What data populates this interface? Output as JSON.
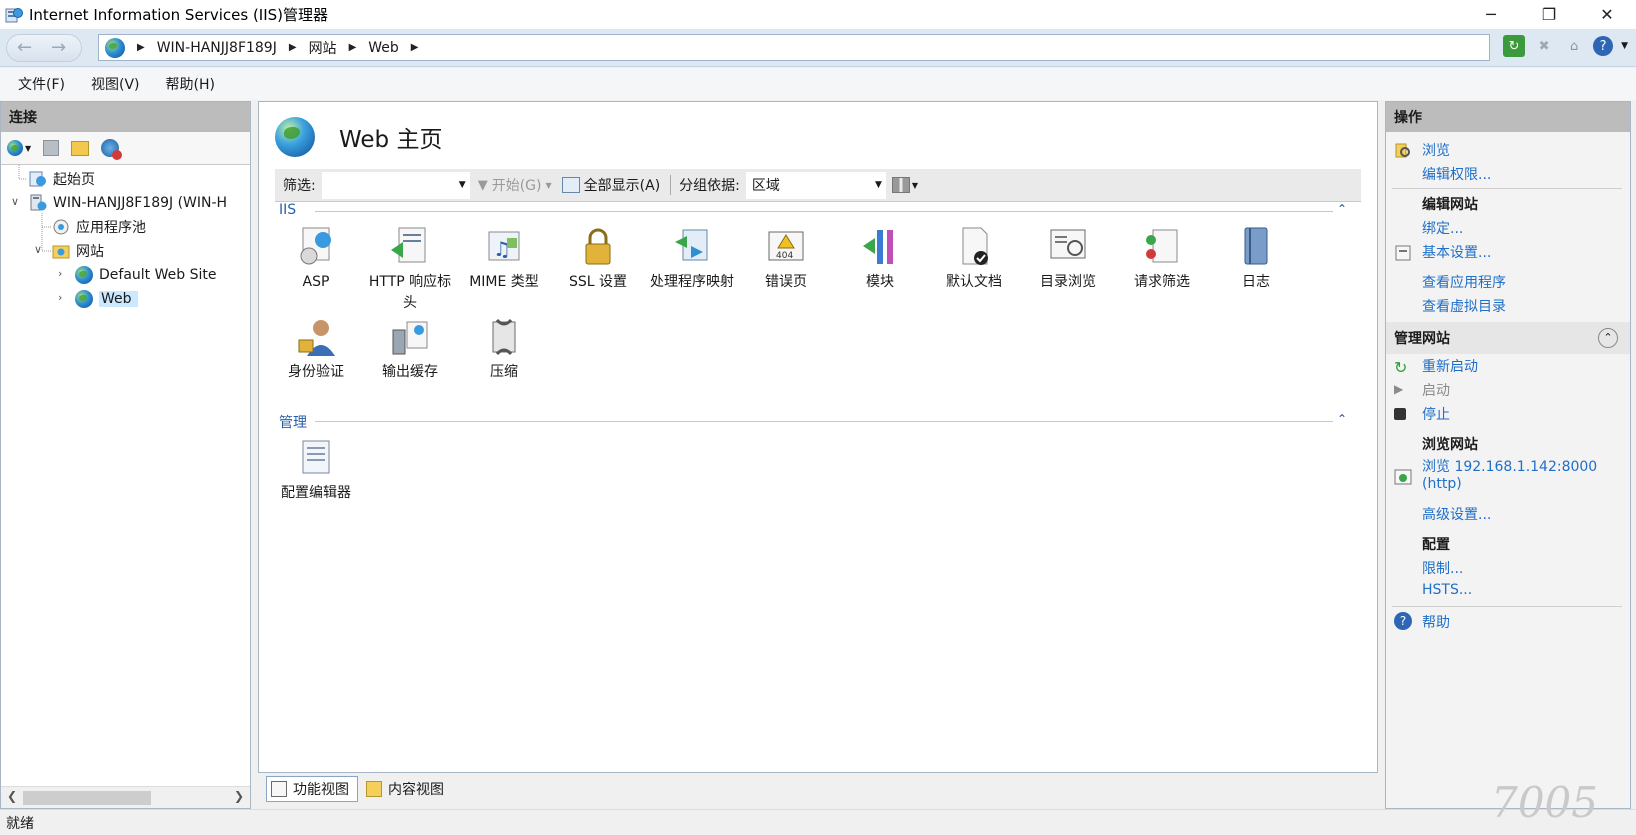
{
  "window": {
    "title": "Internet Information Services (IIS)管理器",
    "minimize": "─",
    "maximize": "❐",
    "close": "✕"
  },
  "address": {
    "crumbs": [
      "WIN-HANJJ8F189J",
      "网站",
      "Web"
    ]
  },
  "menu": [
    "文件(F)",
    "视图(V)",
    "帮助(H)"
  ],
  "connections": {
    "header": "连接",
    "tree": {
      "start_page": "起始页",
      "server": "WIN-HANJJ8F189J (WIN-H",
      "app_pools": "应用程序池",
      "sites": "网站",
      "default_site": "Default Web Site",
      "web": "Web"
    }
  },
  "main": {
    "title": "Web 主页",
    "filter_label": "筛选:",
    "go_label": "开始(G)",
    "show_all_label": "全部显示(A)",
    "group_by_label": "分组依据:",
    "group_by_value": "区域",
    "groups": {
      "iis": {
        "label": "IIS",
        "features": [
          "ASP",
          "HTTP 响应标头",
          "MIME 类型",
          "SSL 设置",
          "处理程序映射",
          "错误页",
          "模块",
          "默认文档",
          "目录浏览",
          "请求筛选",
          "日志",
          "身份验证",
          "输出缓存",
          "压缩"
        ]
      },
      "manage": {
        "label": "管理",
        "features": [
          "配置编辑器"
        ]
      }
    },
    "tabs": [
      "功能视图",
      "内容视图"
    ]
  },
  "actions": {
    "header": "操作",
    "browse": "浏览",
    "edit_permissions": "编辑权限...",
    "edit_site": "编辑网站",
    "bindings": "绑定...",
    "basic_settings": "基本设置...",
    "view_apps": "查看应用程序",
    "view_vdirs": "查看虚拟目录",
    "manage_site": "管理网站",
    "restart": "重新启动",
    "start": "启动",
    "stop": "停止",
    "browse_site": "浏览网站",
    "browse_url_1": "浏览 192.168.1.142:8000",
    "browse_url_2": "(http)",
    "advanced_settings": "高级设置...",
    "config": "配置",
    "limits": "限制...",
    "hsts": "HSTS...",
    "help": "帮助"
  },
  "status": "就绪",
  "watermark": "7005"
}
